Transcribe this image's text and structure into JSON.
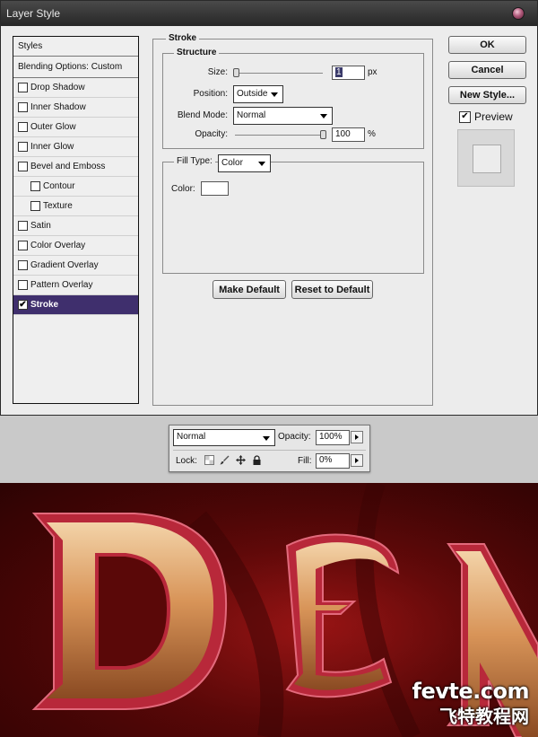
{
  "window": {
    "title": "Layer Style"
  },
  "styles_list": {
    "header": "Styles",
    "blending": "Blending Options: Custom",
    "items": [
      {
        "label": "Drop Shadow",
        "checked": false,
        "sub": false,
        "active": false
      },
      {
        "label": "Inner Shadow",
        "checked": false,
        "sub": false,
        "active": false
      },
      {
        "label": "Outer Glow",
        "checked": false,
        "sub": false,
        "active": false
      },
      {
        "label": "Inner Glow",
        "checked": false,
        "sub": false,
        "active": false
      },
      {
        "label": "Bevel and Emboss",
        "checked": false,
        "sub": false,
        "active": false
      },
      {
        "label": "Contour",
        "checked": false,
        "sub": true,
        "active": false
      },
      {
        "label": "Texture",
        "checked": false,
        "sub": true,
        "active": false
      },
      {
        "label": "Satin",
        "checked": false,
        "sub": false,
        "active": false
      },
      {
        "label": "Color Overlay",
        "checked": false,
        "sub": false,
        "active": false
      },
      {
        "label": "Gradient Overlay",
        "checked": false,
        "sub": false,
        "active": false
      },
      {
        "label": "Pattern Overlay",
        "checked": false,
        "sub": false,
        "active": false
      },
      {
        "label": "Stroke",
        "checked": true,
        "sub": false,
        "active": true
      }
    ]
  },
  "stroke": {
    "title": "Stroke",
    "structure_title": "Structure",
    "size_label": "Size:",
    "size_value": "1",
    "size_unit": "px",
    "position_label": "Position:",
    "position_value": "Outside",
    "blend_label": "Blend Mode:",
    "blend_value": "Normal",
    "opacity_label": "Opacity:",
    "opacity_value": "100",
    "opacity_unit": "%",
    "fill_type_label": "Fill Type:",
    "fill_type_value": "Color",
    "color_label": "Color:",
    "color_value": "#ffffff",
    "make_default": "Make Default",
    "reset_default": "Reset to Default"
  },
  "side_buttons": {
    "ok": "OK",
    "cancel": "Cancel",
    "new_style": "New Style...",
    "preview_label": "Preview",
    "preview_checked": true
  },
  "layers_bar": {
    "blend_value": "Normal",
    "opacity_label": "Opacity:",
    "opacity_value": "100%",
    "lock_label": "Lock:",
    "fill_label": "Fill:",
    "fill_value": "0%"
  },
  "artwork": {
    "letters": "DEN",
    "watermark_main": "fevte.com",
    "watermark_sub": "飞特教程网",
    "bg_color": "#6e0a0a",
    "letter_color": "#e0a670",
    "rim_color": "#b8283a"
  }
}
